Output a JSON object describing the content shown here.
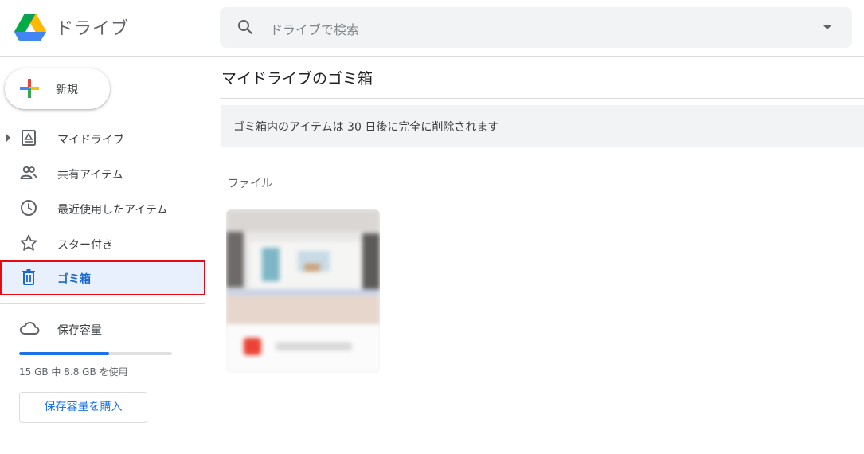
{
  "app": {
    "title": "ドライブ"
  },
  "search": {
    "placeholder": "ドライブで検索"
  },
  "new_button": {
    "label": "新規"
  },
  "nav": {
    "items": [
      {
        "label": "マイドライブ",
        "icon": "drive-icon"
      },
      {
        "label": "共有アイテム",
        "icon": "people-icon"
      },
      {
        "label": "最近使用したアイテム",
        "icon": "clock-icon"
      },
      {
        "label": "スター付き",
        "icon": "star-icon"
      },
      {
        "label": "ゴミ箱",
        "icon": "trash-icon",
        "active": true
      }
    ]
  },
  "storage": {
    "label": "保存容量",
    "usage_text": "15 GB 中 8.8 GB を使用",
    "used_fraction": 0.59,
    "buy_label": "保存容量を購入"
  },
  "main": {
    "title": "マイドライブのゴミ箱",
    "notice": "ゴミ箱内のアイテムは 30 日後に完全に削除されます",
    "section_label": "ファイル"
  },
  "colors": {
    "accent": "#1a73e8",
    "active_bg": "#e8f0fe",
    "highlight_border": "#e50914"
  }
}
